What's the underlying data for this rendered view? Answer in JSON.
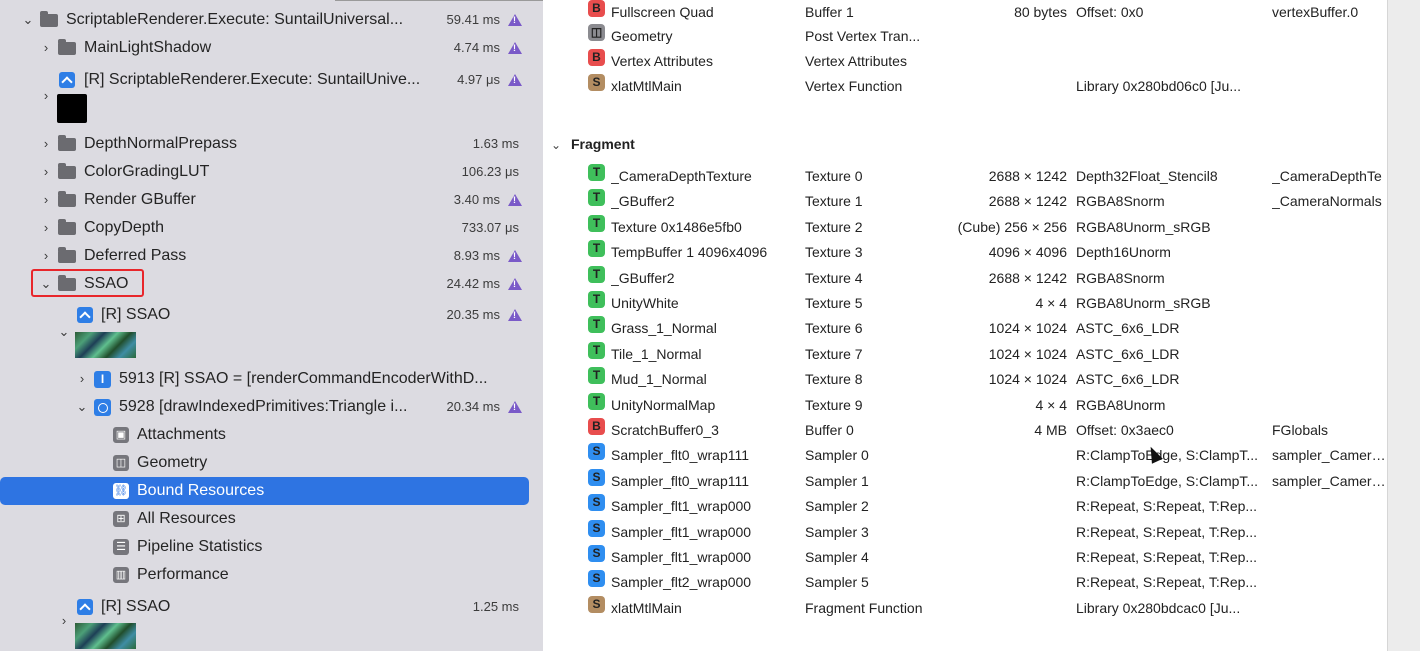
{
  "sidebar": {
    "rows": [
      {
        "name": "ScriptableRenderer.Execute: SuntailUniversal...",
        "time": "59.41 ms",
        "warn": true
      },
      {
        "name": "MainLightShadow",
        "time": "4.74 ms",
        "warn": true
      },
      {
        "name": "[R] ScriptableRenderer.Execute: SuntailUnive...",
        "time": "4.97 μs",
        "warn": true
      },
      {
        "name": "DepthNormalPrepass",
        "time": "1.63 ms",
        "warn": false
      },
      {
        "name": "ColorGradingLUT",
        "time": "106.23 μs",
        "warn": false
      },
      {
        "name": "Render GBuffer",
        "time": "3.40 ms",
        "warn": true
      },
      {
        "name": "CopyDepth",
        "time": "733.07 μs",
        "warn": false
      },
      {
        "name": "Deferred Pass",
        "time": "8.93 ms",
        "warn": true
      },
      {
        "name": "SSAO",
        "time": "24.42 ms",
        "warn": true
      },
      {
        "name": "[R] SSAO",
        "time": "20.35 ms",
        "warn": true
      },
      {
        "name": "5913 [R] SSAO = [renderCommandEncoderWithD...",
        "time": "",
        "warn": false
      },
      {
        "name": "5928 [drawIndexedPrimitives:Triangle i...",
        "time": "20.34 ms",
        "warn": true
      },
      {
        "name": "Attachments",
        "time": "",
        "warn": false
      },
      {
        "name": "Geometry",
        "time": "",
        "warn": false
      },
      {
        "name": "Bound Resources",
        "time": "",
        "warn": false
      },
      {
        "name": "All Resources",
        "time": "",
        "warn": false
      },
      {
        "name": "Pipeline Statistics",
        "time": "",
        "warn": false
      },
      {
        "name": "Performance",
        "time": "",
        "warn": false
      },
      {
        "name": "[R] SSAO",
        "time": "1.25 ms",
        "warn": false
      }
    ]
  },
  "resources": {
    "vertex_rows": [
      {
        "badge": "B",
        "name": "Fullscreen Quad",
        "binding": "Buffer 1",
        "size": "80 bytes",
        "format": "Offset: 0x0",
        "label": "vertexBuffer.0"
      },
      {
        "badge": "G",
        "name": "Geometry",
        "binding": "Post Vertex Tran...",
        "size": "",
        "format": "",
        "label": ""
      },
      {
        "badge": "B",
        "name": "Vertex Attributes",
        "binding": "Vertex Attributes",
        "size": "",
        "format": "",
        "label": ""
      },
      {
        "badge": "S",
        "name": "xlatMtlMain",
        "binding": "Vertex Function",
        "size": "",
        "format": "Library 0x280bd06c0 [Ju...",
        "label": ""
      }
    ],
    "fragment_title": "Fragment",
    "fragment_rows": [
      {
        "badge": "T",
        "name": "_CameraDepthTexture",
        "binding": "Texture 0",
        "size": "2688 × 1242",
        "format": "Depth32Float_Stencil8",
        "label": "_CameraDepthTe"
      },
      {
        "badge": "T",
        "name": "_GBuffer2",
        "binding": "Texture 1",
        "size": "2688 × 1242",
        "format": "RGBA8Snorm",
        "label": "_CameraNormals"
      },
      {
        "badge": "T",
        "name": "Texture 0x1486e5fb0",
        "binding": "Texture 2",
        "size": "(Cube) 256 × 256",
        "format": "RGBA8Unorm_sRGB",
        "label": ""
      },
      {
        "badge": "T",
        "name": "TempBuffer 1 4096x4096",
        "binding": "Texture 3",
        "size": "4096 × 4096",
        "format": "Depth16Unorm",
        "label": ""
      },
      {
        "badge": "T",
        "name": "_GBuffer2",
        "binding": "Texture 4",
        "size": "2688 × 1242",
        "format": "RGBA8Snorm",
        "label": ""
      },
      {
        "badge": "T",
        "name": "UnityWhite",
        "binding": "Texture 5",
        "size": "4 × 4",
        "format": "RGBA8Unorm_sRGB",
        "label": ""
      },
      {
        "badge": "T",
        "name": "Grass_1_Normal",
        "binding": "Texture 6",
        "size": "1024 × 1024",
        "format": "ASTC_6x6_LDR",
        "label": ""
      },
      {
        "badge": "T",
        "name": "Tile_1_Normal",
        "binding": "Texture 7",
        "size": "1024 × 1024",
        "format": "ASTC_6x6_LDR",
        "label": ""
      },
      {
        "badge": "T",
        "name": "Mud_1_Normal",
        "binding": "Texture 8",
        "size": "1024 × 1024",
        "format": "ASTC_6x6_LDR",
        "label": ""
      },
      {
        "badge": "T",
        "name": "UnityNormalMap",
        "binding": "Texture 9",
        "size": "4 × 4",
        "format": "RGBA8Unorm",
        "label": ""
      },
      {
        "badge": "B",
        "name": "ScratchBuffer0_3",
        "binding": "Buffer 0",
        "size": "4 MB",
        "format": "Offset: 0x3aec0",
        "label": "FGlobals"
      },
      {
        "badge": "S",
        "name": "Sampler_flt0_wrap111",
        "binding": "Sampler 0",
        "size": "",
        "format": "R:ClampToEdge, S:ClampT...",
        "label": "sampler_Camera..."
      },
      {
        "badge": "S",
        "name": "Sampler_flt0_wrap111",
        "binding": "Sampler 1",
        "size": "",
        "format": "R:ClampToEdge, S:ClampT...",
        "label": "sampler_Camera..."
      },
      {
        "badge": "S",
        "name": "Sampler_flt1_wrap000",
        "binding": "Sampler 2",
        "size": "",
        "format": "R:Repeat, S:Repeat, T:Rep...",
        "label": ""
      },
      {
        "badge": "S",
        "name": "Sampler_flt1_wrap000",
        "binding": "Sampler 3",
        "size": "",
        "format": "R:Repeat, S:Repeat, T:Rep...",
        "label": ""
      },
      {
        "badge": "S",
        "name": "Sampler_flt1_wrap000",
        "binding": "Sampler 4",
        "size": "",
        "format": "R:Repeat, S:Repeat, T:Rep...",
        "label": ""
      },
      {
        "badge": "S",
        "name": "Sampler_flt2_wrap000",
        "binding": "Sampler 5",
        "size": "",
        "format": "R:Repeat, S:Repeat, T:Rep...",
        "label": ""
      },
      {
        "badge": "Sf",
        "name": "xlatMtlMain",
        "binding": "Fragment Function",
        "size": "",
        "format": "Library 0x280bdcac0 [Ju...",
        "label": ""
      }
    ]
  },
  "colors": {
    "selection": "#2e74e2",
    "highlight_box": "#e8262b",
    "warning": "#7a5ac8",
    "badge_buffer": "#e84d4d",
    "badge_texture": "#3fbf5b",
    "badge_sampler": "#2f8ef0",
    "badge_function": "#b38d62"
  },
  "icons": {
    "folder": "folder-icon",
    "encoder": "render-encoder-icon",
    "warning": "warning-triangle-icon",
    "chevron": "chevron-icon"
  }
}
